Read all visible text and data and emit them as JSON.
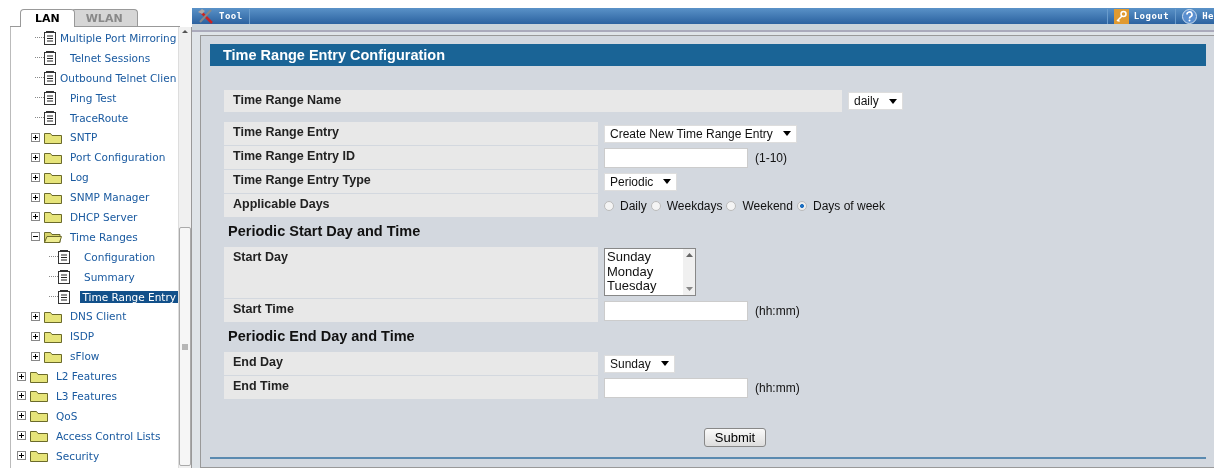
{
  "sidebar": {
    "tabs": [
      {
        "label": "LAN",
        "selected": true
      },
      {
        "label": "WLAN",
        "selected": false
      }
    ],
    "tree": [
      {
        "children": [
          {
            "kind": "leaf",
            "label": "Multiple Port Mirroring",
            "selected": false
          },
          {
            "kind": "leaf",
            "label": "Telnet Sessions",
            "selected": false
          },
          {
            "kind": "leaf",
            "label": "Outbound Telnet Clien",
            "selected": false
          },
          {
            "kind": "leaf",
            "label": "Ping Test",
            "selected": false
          },
          {
            "kind": "leaf",
            "label": "TraceRoute",
            "selected": false
          },
          {
            "kind": "folder",
            "label": "SNTP",
            "expanded": false,
            "selected": false
          },
          {
            "kind": "folder",
            "label": "Port Configuration",
            "expanded": false,
            "selected": false
          },
          {
            "kind": "folder",
            "label": "Log",
            "expanded": false,
            "selected": false
          },
          {
            "kind": "folder",
            "label": "SNMP Manager",
            "expanded": false,
            "selected": false
          },
          {
            "kind": "folder",
            "label": "DHCP Server",
            "expanded": false,
            "selected": false
          },
          {
            "kind": "folder",
            "label": "Time Ranges",
            "expanded": true,
            "selected": false,
            "children": [
              {
                "kind": "leaf",
                "label": "Configuration",
                "selected": false
              },
              {
                "kind": "leaf",
                "label": "Summary",
                "selected": false
              },
              {
                "kind": "leaf",
                "label": "Time Range Entry",
                "selected": true
              }
            ]
          },
          {
            "kind": "folder",
            "label": "DNS Client",
            "expanded": false,
            "selected": false
          },
          {
            "kind": "folder",
            "label": "ISDP",
            "expanded": false,
            "selected": false
          },
          {
            "kind": "folder",
            "label": "sFlow",
            "expanded": false,
            "selected": false
          }
        ]
      },
      {
        "kind": "folder",
        "label": "L2 Features",
        "expanded": false,
        "selected": false
      },
      {
        "kind": "folder",
        "label": "L3 Features",
        "expanded": false,
        "selected": false
      },
      {
        "kind": "folder",
        "label": "QoS",
        "expanded": false,
        "selected": false
      },
      {
        "kind": "folder",
        "label": "Access Control Lists",
        "expanded": false,
        "selected": false
      },
      {
        "kind": "folder",
        "label": "Security",
        "expanded": false,
        "selected": false
      }
    ]
  },
  "toolbar": {
    "left": [
      {
        "kind": "tool",
        "label": "Tool"
      }
    ],
    "right": [
      {
        "kind": "logout",
        "label": "Logout"
      },
      {
        "kind": "help",
        "label": "He"
      }
    ]
  },
  "form": {
    "title": "Time Range Entry Configuration",
    "rows": [
      {
        "kind": "selector",
        "label": "Time Range Name",
        "control": {
          "kind": "select",
          "value": "daily"
        }
      },
      {
        "kind": "field",
        "label": "Time Range Entry",
        "control": {
          "kind": "select",
          "value": "Create New Time Range Entry"
        }
      },
      {
        "kind": "field",
        "label": "Time Range Entry ID",
        "control": {
          "kind": "input"
        },
        "hint": "(1-10)"
      },
      {
        "kind": "field",
        "label": "Time Range Entry Type",
        "control": {
          "kind": "select",
          "value": "Periodic"
        }
      },
      {
        "kind": "field",
        "label": "Applicable Days",
        "control": {
          "kind": "radios",
          "options": [
            {
              "label": "Daily",
              "selected": false
            },
            {
              "label": "Weekdays",
              "selected": false
            },
            {
              "label": "Weekend",
              "selected": false
            },
            {
              "label": "Days of week",
              "selected": true
            }
          ]
        }
      },
      {
        "kind": "heading",
        "label": "Periodic Start Day and Time"
      },
      {
        "kind": "field",
        "label": "Start Day",
        "control": {
          "kind": "listbox",
          "options": [
            "Sunday",
            "Monday",
            "Tuesday"
          ]
        }
      },
      {
        "kind": "field",
        "label": "Start Time",
        "control": {
          "kind": "input"
        },
        "hint": "(hh:mm)"
      },
      {
        "kind": "heading",
        "label": "Periodic End Day and Time"
      },
      {
        "kind": "field",
        "label": "End Day",
        "control": {
          "kind": "select",
          "value": "Sunday"
        }
      },
      {
        "kind": "field",
        "label": "End Time",
        "control": {
          "kind": "input"
        },
        "hint": "(hh:mm)"
      }
    ],
    "submit": "Submit"
  }
}
